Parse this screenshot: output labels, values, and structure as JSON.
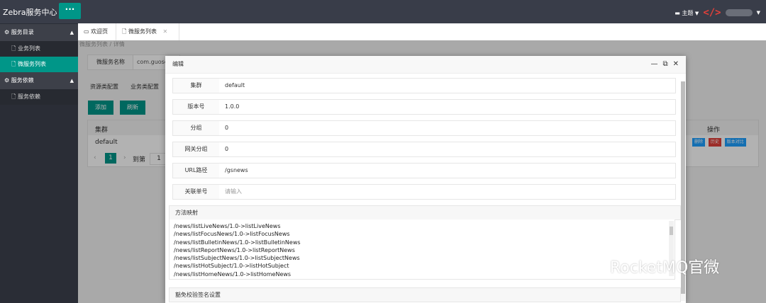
{
  "app": {
    "brand": "Zebra服务中心",
    "menu_label": "···",
    "theme_label": "主题"
  },
  "sidebar": {
    "groups": [
      {
        "label": "服务目录",
        "items": [
          {
            "label": "业务列表"
          },
          {
            "label": "微服务列表"
          }
        ]
      },
      {
        "label": "服务依赖",
        "items": [
          {
            "label": "服务依赖"
          }
        ]
      }
    ]
  },
  "tabs": [
    {
      "label": "欢迎页"
    },
    {
      "label": "微服务列表"
    }
  ],
  "background": {
    "breadcrumb": "微服务列表 / 详情",
    "service_name_label": "微服务名称",
    "service_name_value": "com.guosen",
    "config_tabs": [
      "资源类配置",
      "业务类配置"
    ],
    "buttons": {
      "add": "添加",
      "refresh": "刷新"
    },
    "table": {
      "col_cluster": "集群",
      "col_ops": "操作",
      "row_cluster": "default",
      "ops": [
        "删除",
        "历史",
        "版本对比"
      ]
    },
    "pager": {
      "current": "1",
      "goto": "到第",
      "page_input": "1"
    }
  },
  "modal": {
    "title": "编辑",
    "fields": [
      {
        "label": "集群",
        "value": "default"
      },
      {
        "label": "版本号",
        "value": "1.0.0"
      },
      {
        "label": "分组",
        "value": "0"
      },
      {
        "label": "网关分组",
        "value": "0"
      },
      {
        "label": "URL路径",
        "value": "/gsnews"
      },
      {
        "label": "关联单号",
        "placeholder": "请输入"
      }
    ],
    "method_mapping_title": "方法映射",
    "methods": [
      "/news/listLiveNews/1.0->listLiveNews",
      "/news/listFocusNews/1.0->listFocusNews",
      "/news/listBulletinNews/1.0->listBulletinNews",
      "/news/listReportNews/1.0->listReportNews",
      "/news/listSubjectNews/1.0->listSubjectNews",
      "/news/listHotSubject/1.0->listHotSubject",
      "/news/listHomeNews/1.0->listHomeNews"
    ],
    "signature_title": "豁免校验签名设置"
  },
  "watermark": "RocketMQ官微",
  "colors": {
    "accent": "#009688",
    "topbar": "#393D49",
    "sidebar": "#2a2d36",
    "danger": "#e0403a",
    "info": "#1E9FFF"
  },
  "icons": {
    "settings": "gear-icon",
    "doc": "file-icon",
    "window": "window-icon",
    "minimize": "minimize-icon",
    "maximize": "maximize-icon",
    "close": "close-icon"
  }
}
